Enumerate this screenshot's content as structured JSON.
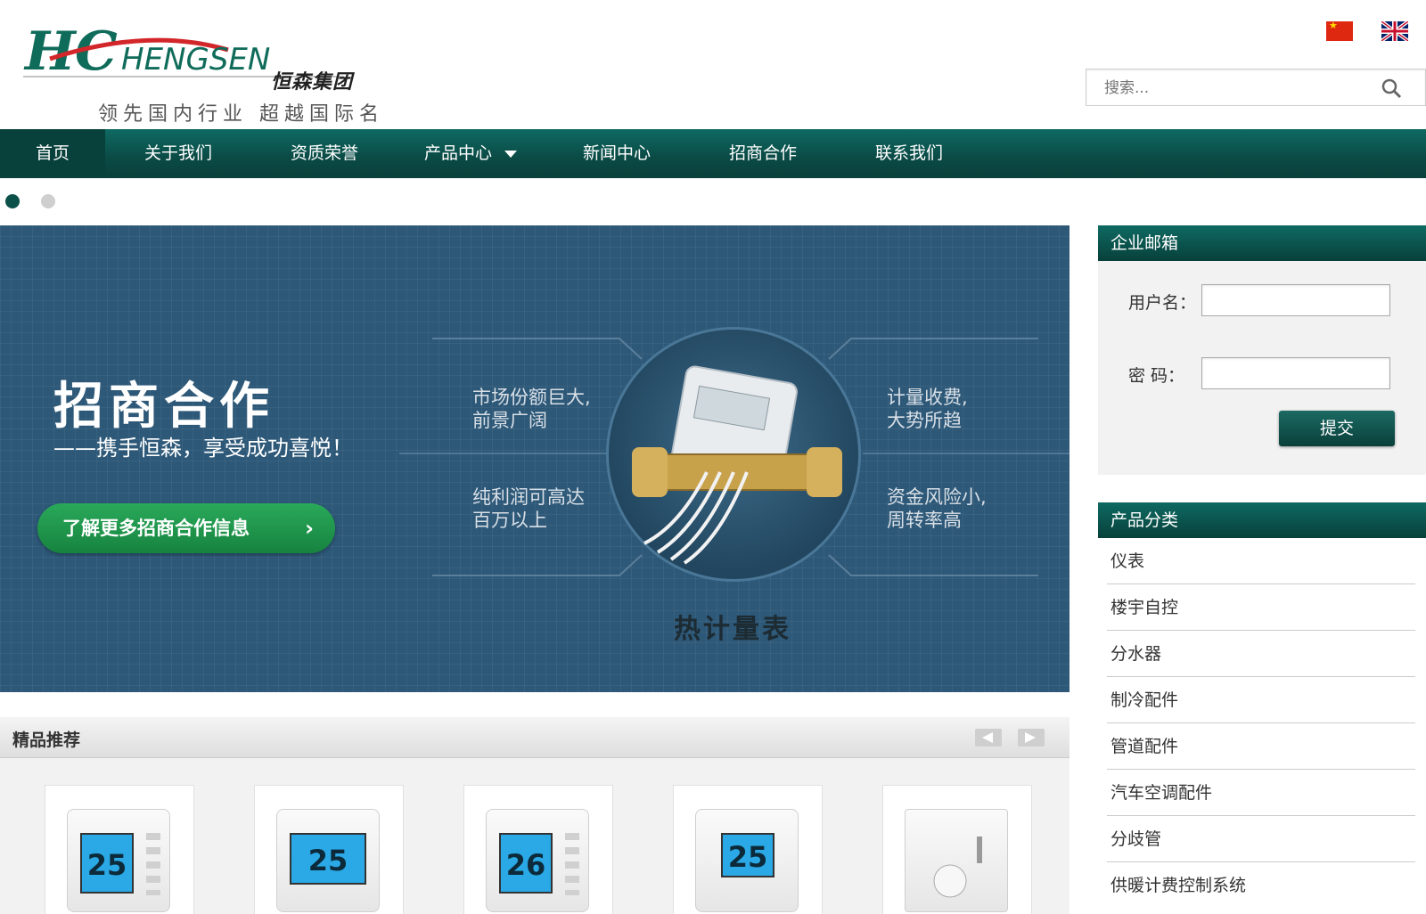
{
  "header": {
    "logo_text": "HENGSEN",
    "logo_cn": "恒森集团",
    "tagline": "领先国内行业 超越国际名牌",
    "search_placeholder": "搜索..."
  },
  "nav": {
    "items": [
      "首页",
      "关于我们",
      "资质荣誉",
      "产品中心",
      "新闻中心",
      "招商合作",
      "联系我们"
    ]
  },
  "banner": {
    "title": "招商合作",
    "subtitle": "——携手恒森，享受成功喜悦！",
    "button_label": "了解更多招商合作信息",
    "features": [
      "市场份额巨大,\n前景广阔",
      "计量收费,\n大势所趋",
      "纯利润可高达\n百万以上",
      "资金风险小,\n周转率高"
    ],
    "product_label": "热计量表"
  },
  "featured": {
    "title": "精品推荐",
    "temps": [
      "25",
      "25",
      "26",
      "25",
      ""
    ]
  },
  "mail": {
    "title": "企业邮箱",
    "username_label": "用户名：",
    "password_label": "密 码：",
    "submit_label": "提交"
  },
  "categories": {
    "title": "产品分类",
    "items": [
      "仪表",
      "楼宇自控",
      "分水器",
      "制冷配件",
      "管道配件",
      "汽车空调配件",
      "分歧管",
      "供暖计费控制系统"
    ]
  },
  "colors": {
    "primary": "#0b4a45",
    "banner": "#2d5878",
    "button_green": "#1e9a4c"
  }
}
